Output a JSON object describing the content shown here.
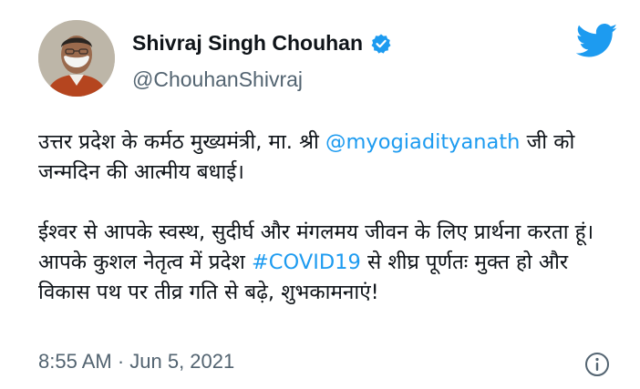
{
  "profile": {
    "display_name": "Shivraj Singh Chouhan",
    "handle": "@ChouhanShivraj"
  },
  "tweet": {
    "p1_text_a": "उत्तर प्रदेश के कर्मठ मुख्यमंत्री, मा. श्री ",
    "p1_mention": "@myogiadityanath",
    "p1_text_b": " जी को जन्मदिन की आत्मीय बधाई।",
    "p2_text_a": "ईश्वर से आपके स्वस्थ, सुदीर्घ और मंगलमय जीवन के लिए प्रार्थना करता हूं। आपके कुशल नेतृत्व में प्रदेश ",
    "p2_hashtag": "#COVID19",
    "p2_text_b": " से शीघ्र पूर्णतः मुक्त हो और विकास पथ पर तीव्र गति से बढ़े, शुभकामनाएं!"
  },
  "footer": {
    "timestamp": "8:55 AM · Jun 5, 2021"
  },
  "icons": {
    "verified": "verified-badge-icon",
    "twitter": "twitter-bird-icon",
    "info": "info-icon"
  },
  "colors": {
    "brand_blue": "#1d9bf0",
    "text": "#0f1419",
    "secondary_text": "#536471"
  }
}
